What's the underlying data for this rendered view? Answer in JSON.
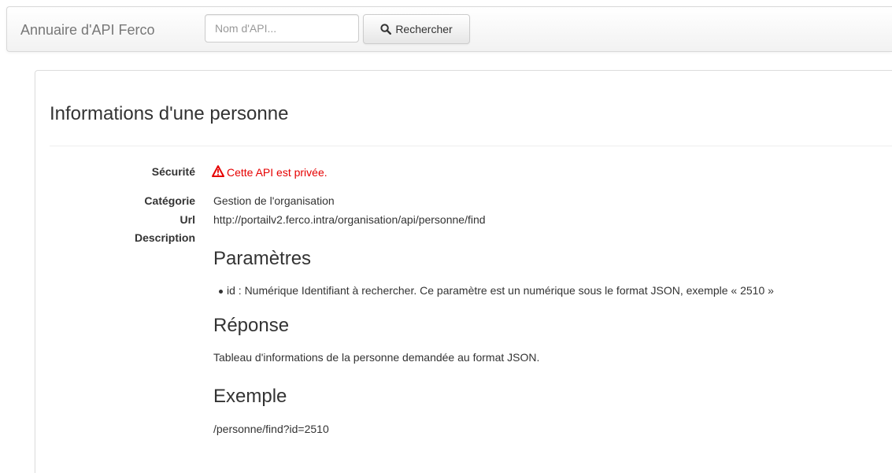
{
  "navbar": {
    "brand": "Annuaire d'API Ferco",
    "search_placeholder": "Nom d'API...",
    "search_value": "",
    "search_button_label": "Rechercher",
    "search_button_icon": "magnifier-icon"
  },
  "api": {
    "title": "Informations d'une personne",
    "fields": {
      "security_label": "Sécurité",
      "security_value": "Cette API est privée.",
      "security_icon": "warning-triangle-icon",
      "security_color": "#e60000",
      "category_label": "Catégorie",
      "category_value": "Gestion de l'organisation",
      "url_label": "Url",
      "url_value": "http://portailv2.ferco.intra/organisation/api/personne/find",
      "description_label": "Description"
    },
    "description": {
      "parameters_heading": "Paramètres",
      "parameters": [
        "id : Numérique Identifiant à rechercher. Ce paramètre est un numérique sous le format JSON, exemple « 2510 »"
      ],
      "response_heading": "Réponse",
      "response_text": "Tableau d'informations de la personne demandée au format JSON.",
      "example_heading": "Exemple",
      "example_text": "/personne/find?id=2510"
    }
  }
}
